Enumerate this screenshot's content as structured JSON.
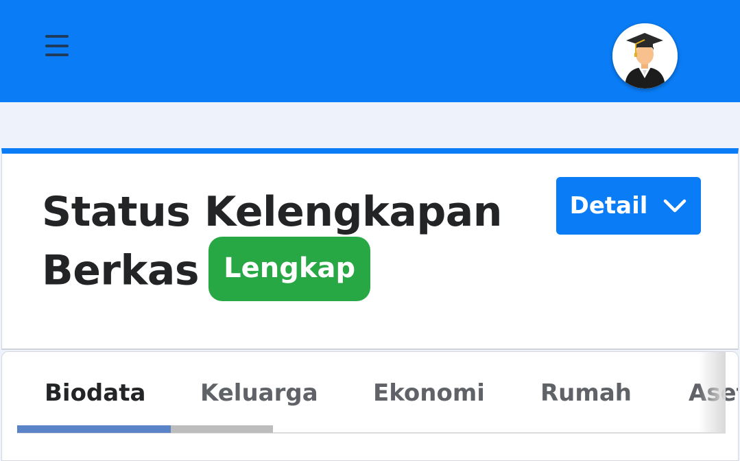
{
  "header": {
    "menu_icon": "hamburger-icon",
    "avatar_icon": "graduate-avatar-icon",
    "background": "#0a7cf5"
  },
  "status_card": {
    "title": "Status Kelengkapan Berkas",
    "badge": "Lengkap",
    "badge_color": "#28a745",
    "detail_button": "Detail",
    "detail_icon": "chevron-down-icon"
  },
  "tabs": [
    {
      "label": "Biodata",
      "active": true
    },
    {
      "label": "Keluarga",
      "active": false
    },
    {
      "label": "Ekonomi",
      "active": false
    },
    {
      "label": "Rumah",
      "active": false
    },
    {
      "label": "Aset",
      "active": false
    }
  ],
  "colors": {
    "accent": "#0a7cf5",
    "success": "#28a745",
    "scroll_thumb": "#5b83c7"
  }
}
